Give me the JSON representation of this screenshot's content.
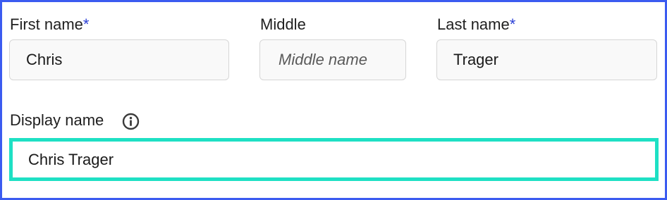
{
  "form": {
    "first_name": {
      "label": "First name",
      "required_mark": "*",
      "value": "Chris"
    },
    "middle": {
      "label": "Middle",
      "placeholder": "Middle name",
      "value": ""
    },
    "last_name": {
      "label": "Last name",
      "required_mark": "*",
      "value": "Trager"
    },
    "display_name": {
      "label": "Display name",
      "value": "Chris Trager",
      "info_icon": "info-circle-icon"
    }
  },
  "colors": {
    "frame_border": "#3b5bf0",
    "required": "#2a3fd6",
    "focus_highlight": "#1ee0c4"
  }
}
